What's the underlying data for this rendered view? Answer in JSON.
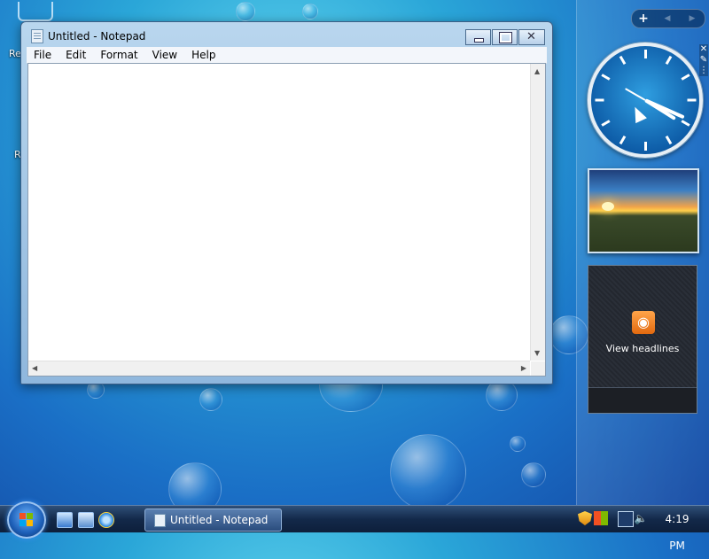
{
  "window": {
    "title": "Untitled - Notepad",
    "menu": [
      "File",
      "Edit",
      "Format",
      "View",
      "Help"
    ],
    "content": ""
  },
  "desktop": {
    "icon_fragments": [
      "Re",
      "R"
    ]
  },
  "sidebar": {
    "add_symbol": "+",
    "nav_symbols": [
      "◀",
      "▶"
    ],
    "clock": {
      "time": "4:19"
    },
    "feed": {
      "label": "View headlines"
    }
  },
  "taskbar": {
    "task_label": "Untitled - Notepad",
    "clock": "4:19 PM"
  },
  "colors": {
    "accent": "#1a6fc6",
    "rss": "#f28a1a"
  }
}
